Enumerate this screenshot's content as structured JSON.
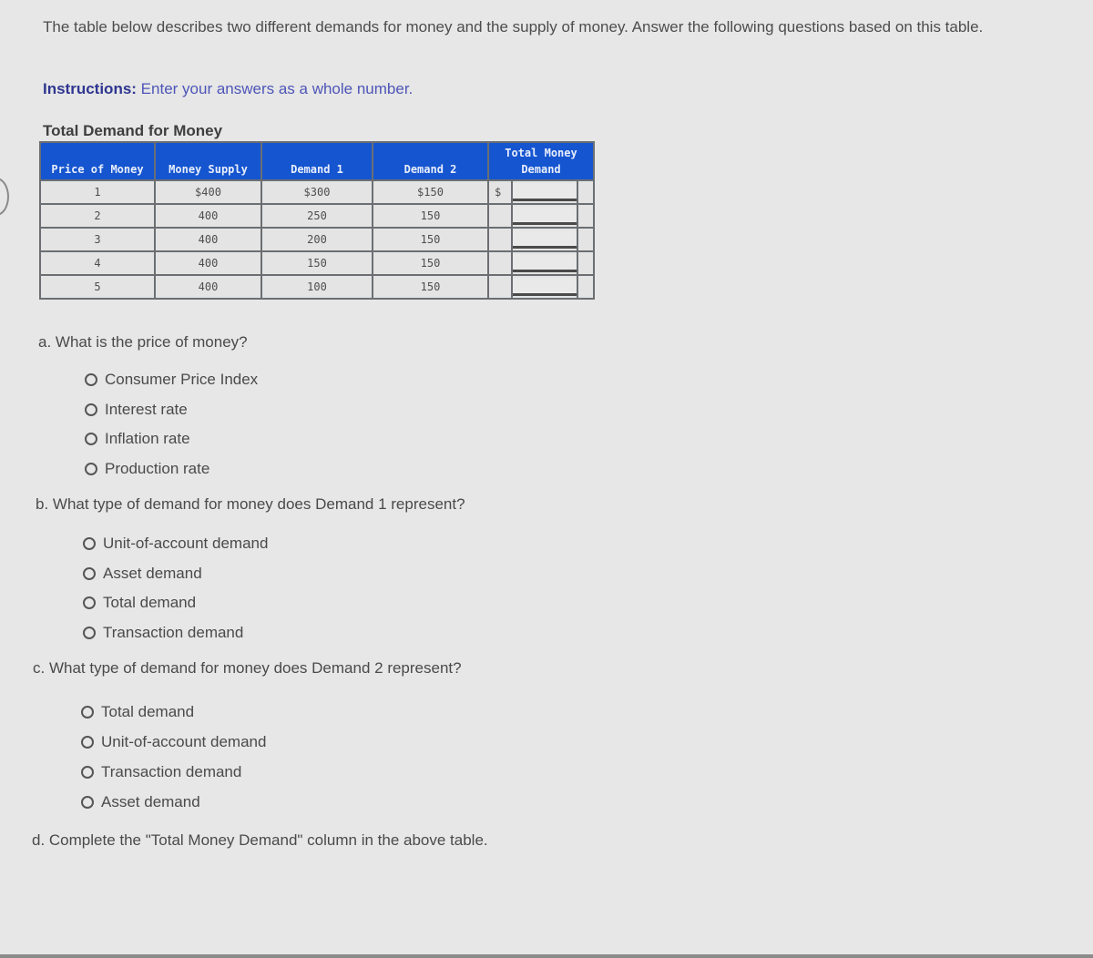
{
  "intro_text": "The table below describes two different demands for money and the supply of money. Answer the following questions based on this table.",
  "instructions": {
    "label": "Instructions:",
    "text": " Enter your answers as a whole number."
  },
  "table": {
    "title": "Total Demand for Money",
    "headers": [
      "Price of Money",
      "Money Supply",
      "Demand 1",
      "Demand 2",
      "Total Money Demand"
    ],
    "currency_symbol": "$",
    "rows": [
      {
        "price": "1",
        "supply": "$400",
        "demand1": "$300",
        "demand2": "$150",
        "total": ""
      },
      {
        "price": "2",
        "supply": "400",
        "demand1": "250",
        "demand2": "150",
        "total": ""
      },
      {
        "price": "3",
        "supply": "400",
        "demand1": "200",
        "demand2": "150",
        "total": ""
      },
      {
        "price": "4",
        "supply": "400",
        "demand1": "150",
        "demand2": "150",
        "total": ""
      },
      {
        "price": "5",
        "supply": "400",
        "demand1": "100",
        "demand2": "150",
        "total": ""
      }
    ]
  },
  "questions": [
    {
      "prompt": "a. What is the price of money?",
      "options": [
        "Consumer Price Index",
        "Interest rate",
        "Inflation rate",
        "Production rate"
      ]
    },
    {
      "prompt": "b. What type of demand for money does Demand 1 represent?",
      "options": [
        "Unit-of-account demand",
        "Asset demand",
        "Total demand",
        "Transaction demand"
      ]
    },
    {
      "prompt": "c. What type of demand for money does Demand 2 represent?",
      "options": [
        "Total demand",
        "Unit-of-account demand",
        "Transaction demand",
        "Asset demand"
      ]
    },
    {
      "prompt": "d. Complete the \"Total Money Demand\" column in the above table."
    }
  ]
}
